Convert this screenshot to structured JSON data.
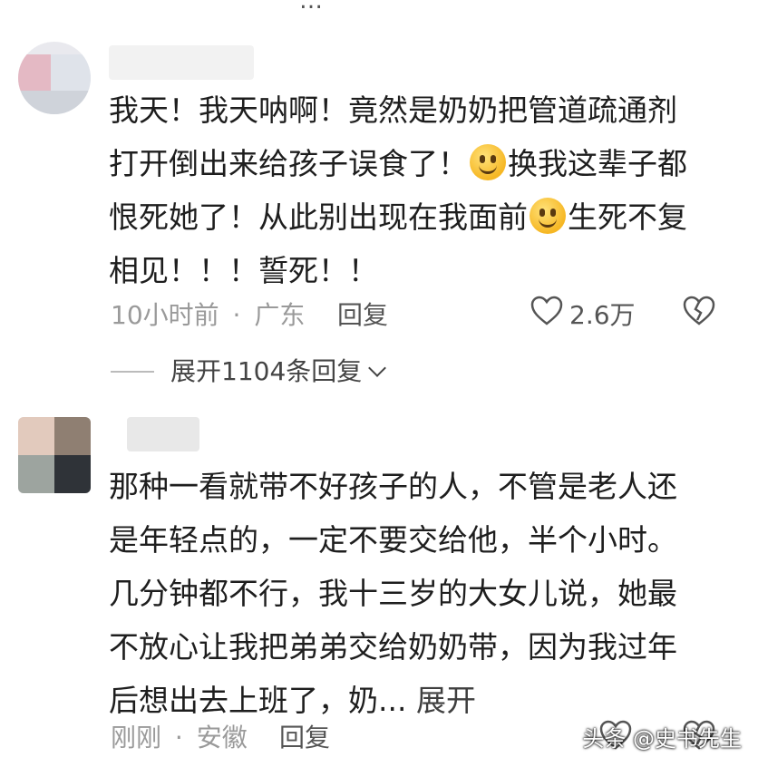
{
  "top_partial": "…",
  "comments": [
    {
      "lines": [
        "我天！我天呐啊！竟然是奶奶把管道疏通剂",
        "打开倒出来给孩子误食了！",
        "换我这辈子都",
        "恨死她了！从此别出现在我面前",
        "生死不复",
        "相见！！！誓死！！"
      ],
      "time": "10小时前",
      "dot": "·",
      "location": "广东",
      "reply_label": "回复",
      "likes": "2.6万",
      "expand_label": "展开1104条回复"
    },
    {
      "lines": [
        "那种一看就带不好孩子的人，不管是老人还",
        "是年轻点的，一定不要交给他，半个小时。",
        "几分钟都不行，我十三岁的大女儿说，她最",
        "不放心让我把弟弟交给奶奶带，因为我过年",
        "后想出去上班了，奶..."
      ],
      "more_label": "展开",
      "time": "刚刚",
      "dot": "·",
      "location": "安徽",
      "reply_label": "回复"
    }
  ],
  "watermark": "头条 @史书先生",
  "icons": {
    "emoji": "smiling-face-icon",
    "like": "heart-outline-icon",
    "dislike": "broken-heart-icon",
    "expand": "chevron-down-icon"
  }
}
